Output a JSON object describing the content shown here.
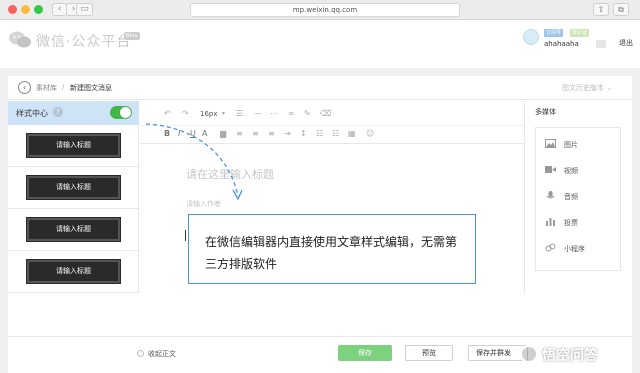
{
  "browser": {
    "url": "mp.weixin.qq.com",
    "light_colors": [
      "#fc605c",
      "#fdbc40",
      "#34c84a"
    ]
  },
  "header": {
    "title": "微信·公众平台",
    "beta": "Beta",
    "account_badge": "订阅号",
    "verified_badge": "未认证",
    "account_name": "ahahaaha",
    "logout": "退出"
  },
  "breadcrumb": {
    "parent": "素材库",
    "separator": "/",
    "current": "新建图文消息",
    "history": "图文历史版本 ⌄"
  },
  "sidebar": {
    "style_center_label": "样式中心",
    "help_icon": "?",
    "toggle_on": true,
    "templates": [
      "请输入标题",
      "请输入标题",
      "请输入标题",
      "请输入标题"
    ]
  },
  "editor": {
    "font_size": "16px",
    "title_placeholder": "请在这里输入标题",
    "author_placeholder": "请输入作者"
  },
  "media": {
    "title": "多媒体",
    "items": [
      {
        "label": "图片",
        "icon": "image-icon"
      },
      {
        "label": "视频",
        "icon": "video-icon"
      },
      {
        "label": "音频",
        "icon": "audio-icon"
      },
      {
        "label": "投票",
        "icon": "vote-icon"
      },
      {
        "label": "小程序",
        "icon": "mini-program-icon"
      }
    ]
  },
  "bottom": {
    "collapse_label": "收起正文",
    "save": "保存",
    "preview": "预览",
    "publish": "保存并群发"
  },
  "callout": {
    "text": "在微信编辑器内直接使用文章样式编辑，无需第三方排版软件"
  },
  "watermark": {
    "text": "悟空问答"
  },
  "colors": {
    "accent_green": "#44b549",
    "callout_border": "#4d94e0",
    "style_center_bg": "#cfe3f7"
  }
}
